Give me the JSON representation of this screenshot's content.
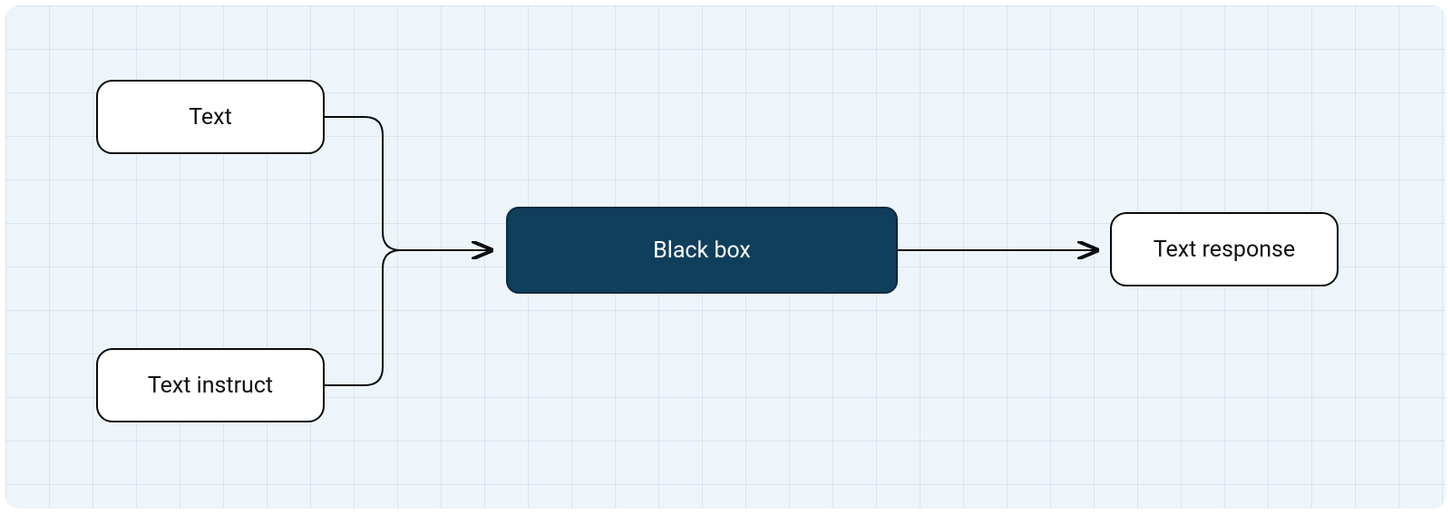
{
  "diagram": {
    "inputs": [
      {
        "label": "Text"
      },
      {
        "label": "Text instruct"
      }
    ],
    "central": {
      "label": "Black box"
    },
    "output": {
      "label": "Text response"
    }
  },
  "colors": {
    "background": "#eef5fa",
    "node_bg": "#ffffff",
    "node_border": "#0a0a0a",
    "central_bg": "#103f5c",
    "central_text": "#ffffff"
  }
}
